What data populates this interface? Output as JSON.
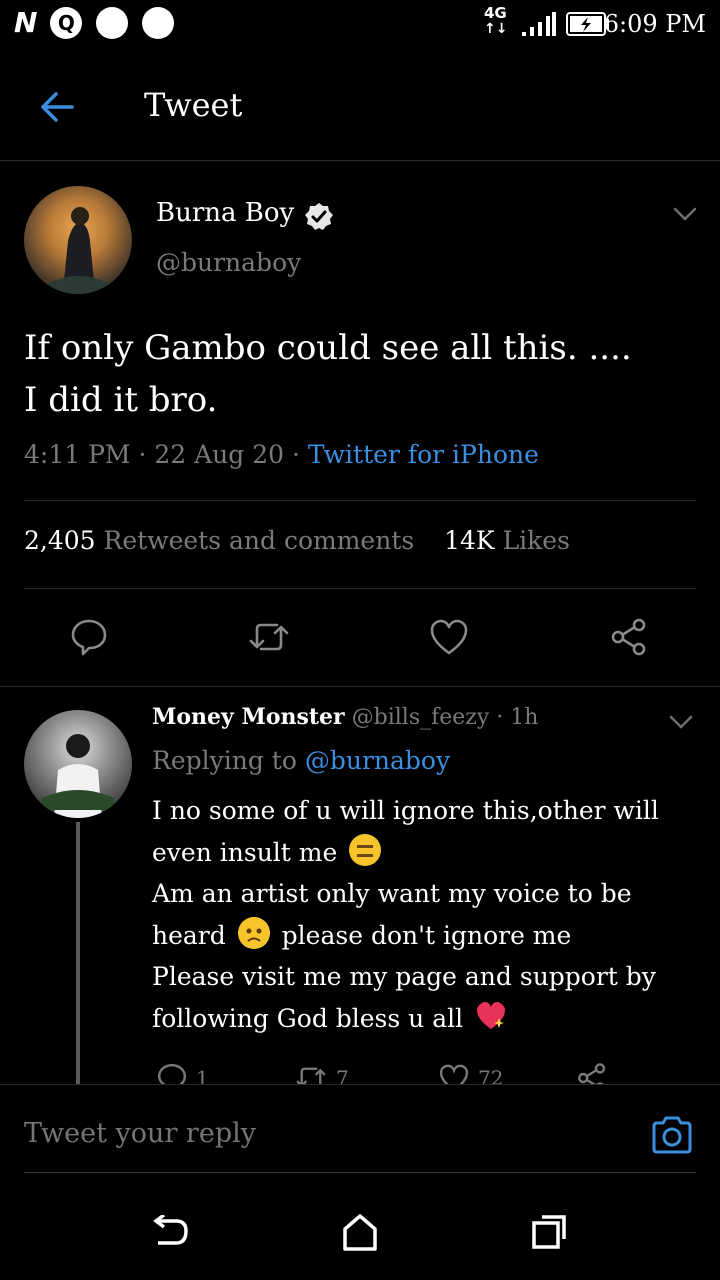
{
  "status_bar": {
    "left_glyphs": [
      "N",
      "Q"
    ],
    "network": "4G",
    "time": "6:09 PM"
  },
  "header": {
    "title": "Tweet",
    "back_icon": "arrow-left-icon"
  },
  "tweet": {
    "author_name": "Burna Boy",
    "author_handle": "@burnaboy",
    "verified": true,
    "text_line1": "If only Gambo could see all this. ....",
    "text_line2": "I did it bro.",
    "meta_time": "4:11 PM · 22 Aug 20 · ",
    "source": "Twitter for iPhone",
    "retweets_count": "2,405",
    "retweets_label": "Retweets and comments",
    "likes_count": "14K",
    "likes_label": "Likes",
    "actions": [
      "reply-icon",
      "retweet-icon",
      "heart-icon",
      "share-icon"
    ]
  },
  "reply": {
    "name": "Money Monster",
    "handle_time": "@bills_feezy · 1h",
    "replying_prefix": "Replying to ",
    "replying_handle": "@burnaboy",
    "line1": "I no some of u will ignore this,other will",
    "line2": "even insult me",
    "line3": "Am an artist only want my voice to be",
    "line4a": "heard",
    "line4b": "please don't ignore me",
    "line5": "Please visit me my page and support by",
    "line6": "following God bless u all",
    "reply_count": "1",
    "retweet_count": "7",
    "like_count": "72"
  },
  "compose": {
    "placeholder": "Tweet your reply",
    "camera_icon": "camera-icon"
  },
  "colors": {
    "background": "#000000",
    "accent": "#3b8fe0",
    "muted_text": "#7a7a7a",
    "divider": "#2b2b2b"
  }
}
